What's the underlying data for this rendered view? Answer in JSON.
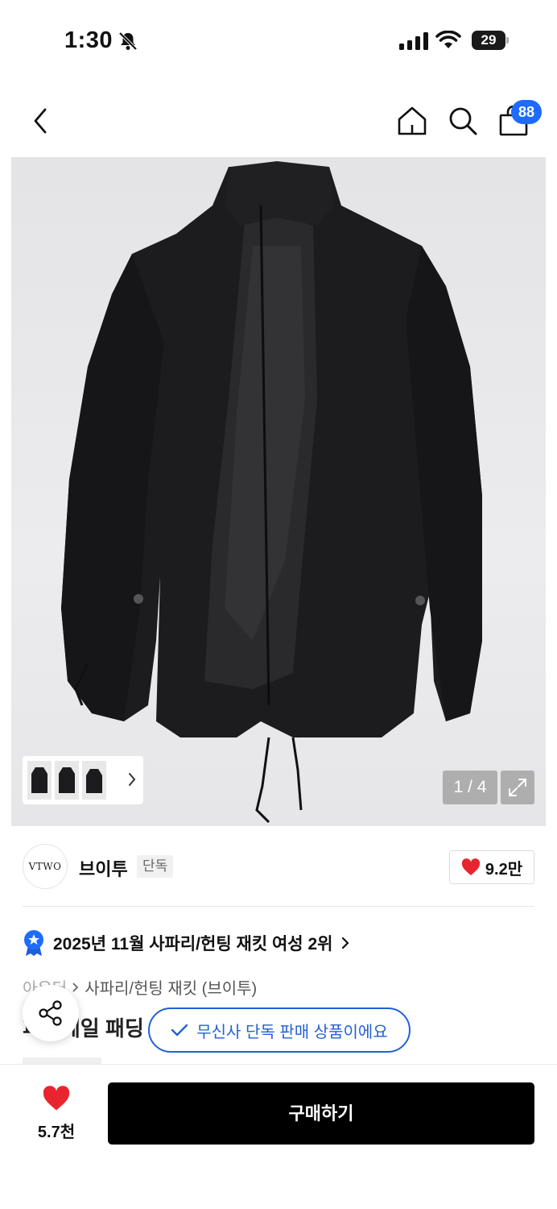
{
  "status_bar": {
    "time": "1:30",
    "battery": "29"
  },
  "nav": {
    "cart_badge": "88"
  },
  "gallery": {
    "page_indicator": "1 / 4"
  },
  "brand": {
    "logo_text": "VTWO",
    "name": "브이투",
    "exclusive_tag": "단독",
    "like_count": "9.2만"
  },
  "ranking": {
    "text": "2025년 11월 사파리/헌팅 재킷 여성 2위"
  },
  "breadcrumb": {
    "parent": "아우터",
    "current": "사파리/헌팅 재킷 (브이투)"
  },
  "product": {
    "title_partial": "피쉬테일 패딩"
  },
  "toast": {
    "text": "무신사 단독 판매 상품이에요"
  },
  "bottom_bar": {
    "like_count": "5.7천",
    "buy_label": "구매하기"
  },
  "colors": {
    "accent_blue": "#2360d8",
    "badge_blue": "#1f6bff",
    "heart_red": "#e8252f"
  }
}
